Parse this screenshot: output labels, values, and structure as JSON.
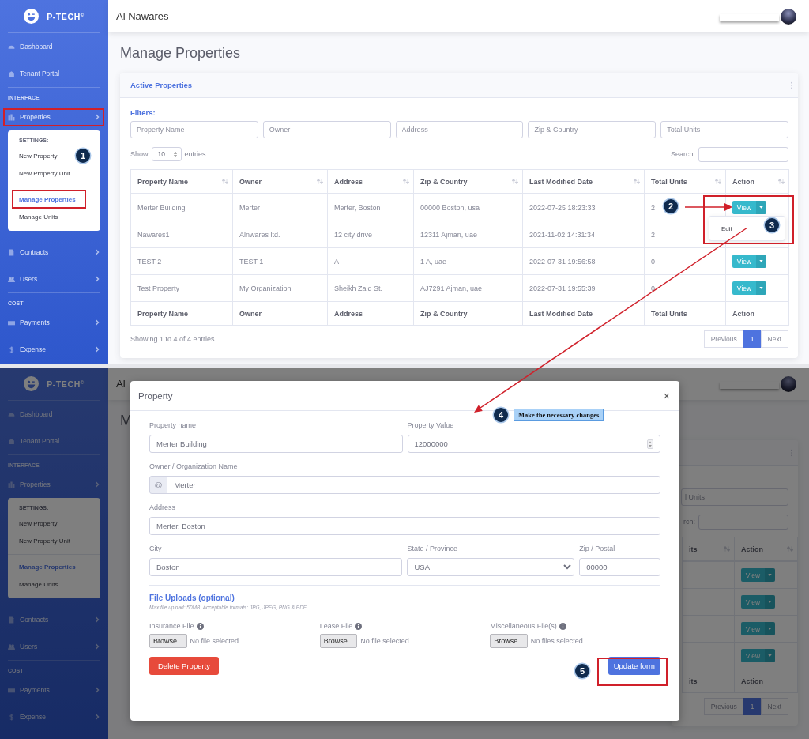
{
  "top_screen": {
    "brand": "P-TECH$^{©}$",
    "sidebar": {
      "items": [
        {
          "kind": "link",
          "label": "Dashboard"
        },
        {
          "kind": "link",
          "label": "Tenant Portal"
        },
        {
          "kind": "heading",
          "label": "INTERFACE"
        },
        {
          "kind": "group",
          "label": "Properties",
          "expanded": true,
          "sections": [
            {
              "heading": "SETTINGS:",
              "items": [
                {
                  "label": "New Property",
                  "selected": false
                },
                {
                  "label": "New Property Unit",
                  "selected": false
                }
              ]
            },
            {
              "items": [
                {
                  "label": "Manage Properties",
                  "selected": true
                },
                {
                  "label": "Manage Units",
                  "selected": false
                }
              ]
            }
          ]
        },
        {
          "kind": "group",
          "label": "Contracts"
        },
        {
          "kind": "group",
          "label": "Users"
        },
        {
          "kind": "heading",
          "label": "COST"
        },
        {
          "kind": "group",
          "label": "Payments"
        },
        {
          "kind": "group",
          "label": "Expense"
        }
      ]
    },
    "topbar": {
      "title": "Al Nawares"
    },
    "page_title": "Manage Properties",
    "card": {
      "title": "Active Properties",
      "filters_label": "Filters:",
      "filters": [
        {
          "placeholder": "Property Name"
        },
        {
          "placeholder": "Owner"
        },
        {
          "placeholder": "Address"
        },
        {
          "placeholder": "Zip & Country"
        },
        {
          "placeholder": "Total Units"
        }
      ],
      "length_menu": {
        "before": "Show",
        "value": "10",
        "after": "entries"
      },
      "search_label": "Search:",
      "columns": [
        "Property Name",
        "Owner",
        "Address",
        "Zip & Country",
        "Last Modified Date",
        "Total Units",
        "Action"
      ],
      "rows": [
        {
          "cells": [
            "Merter Building",
            "Merter",
            "Merter, Boston",
            "00000 Boston, usa",
            "2022-07-25 18:23:33",
            "2"
          ],
          "action": "View",
          "menu": [
            "Edit"
          ]
        },
        {
          "cells": [
            "Nawares1",
            "Alnwares ltd.",
            "12 city drive",
            "12311 Ajman, uae",
            "2021-11-02 14:31:34",
            "2"
          ]
        },
        {
          "cells": [
            "TEST 2",
            "TEST 1",
            "A",
            "1 A, uae",
            "2022-07-31 19:56:58",
            "0"
          ],
          "action": "View"
        },
        {
          "cells": [
            "Test Property",
            "My Organization",
            "Sheikh Zaid St.",
            "AJ7291 Ajman, uae",
            "2022-07-31 19:55:39",
            "0"
          ],
          "action": "View"
        }
      ],
      "footer_columns": [
        "Property Name",
        "Owner",
        "Address",
        "Zip & Country",
        "Last Modified Date",
        "Total Units",
        "Action"
      ],
      "info": "Showing 1 to 4 of 4 entries",
      "pagination": [
        {
          "label": "Previous",
          "selected": false
        },
        {
          "label": "1",
          "selected": true
        },
        {
          "label": "Next",
          "selected": false
        }
      ]
    }
  },
  "bottom_screen": {
    "brand": "P-TECH$^{©}$",
    "modal_open": true,
    "sidebar": {
      "items": [
        {
          "kind": "link",
          "label": "Dashboard"
        },
        {
          "kind": "link",
          "label": "Tenant Portal"
        },
        {
          "kind": "heading",
          "label": "INTERFACE"
        },
        {
          "kind": "group",
          "label": "Properties",
          "expanded": true,
          "sections": [
            {
              "heading": "SETTINGS:",
              "items": [
                {
                  "label": "New Property",
                  "selected": false
                },
                {
                  "label": "New Property Unit",
                  "selected": false
                }
              ]
            },
            {
              "items": [
                {
                  "label": "Manage Properties",
                  "selected": true
                },
                {
                  "label": "Manage Units",
                  "selected": false
                }
              ]
            }
          ]
        },
        {
          "kind": "group",
          "label": "Contracts"
        },
        {
          "kind": "group",
          "label": "Users"
        },
        {
          "kind": "heading",
          "label": "COST"
        },
        {
          "kind": "group",
          "label": "Payments"
        },
        {
          "kind": "group",
          "label": "Expense"
        }
      ]
    },
    "topbar": {
      "title": "Al"
    },
    "page_title": "M",
    "card": {
      "filters": [
        {
          "placeholder": "l Units"
        }
      ],
      "search_label": "rch:",
      "columns": [
        "its",
        "Action"
      ],
      "rows": [
        {
          "action": "View"
        },
        {
          "action": "View"
        },
        {
          "action": "View"
        },
        {
          "action": "View"
        }
      ],
      "footer_columns": [
        "its",
        "Action"
      ],
      "pagination": [
        {
          "label": "Previous",
          "selected": false
        },
        {
          "label": "1",
          "selected": true
        },
        {
          "label": "Next",
          "selected": false
        }
      ]
    },
    "modal": {
      "title": "Property",
      "close": "×",
      "rows": [
        {
          "fields": [
            {
              "kind": "text",
              "label": "Property name",
              "value": "Merter Building"
            },
            {
              "kind": "number",
              "label": "Property Value",
              "value": "12000000"
            }
          ]
        },
        {
          "fields": [
            {
              "kind": "prefixed",
              "label": "Owner / Organization Name",
              "prefix": "@",
              "value": "Merter"
            }
          ]
        },
        {
          "fields": [
            {
              "kind": "text",
              "label": "Address",
              "value": "Merter, Boston"
            }
          ]
        },
        {
          "fields": [
            {
              "kind": "text",
              "label": "City",
              "value": "Boston"
            },
            {
              "kind": "select",
              "label": "State / Province",
              "value": "USA"
            },
            {
              "kind": "text",
              "label": "Zip / Postal",
              "value": "00000"
            }
          ]
        }
      ],
      "uploads": {
        "title": "File Uploads (optional)",
        "hint": "Max file upload: 50MB. Acceptable formats: JPG, JPEG, PNG & PDF",
        "files": [
          {
            "label": "Insurance File",
            "button": "Browse...",
            "status": "No file selected."
          },
          {
            "label": "Lease File",
            "button": "Browse...",
            "status": "No file selected."
          },
          {
            "label": "Miscellaneous File(s)",
            "button": "Browse...",
            "status": "No files selected."
          }
        ]
      },
      "buttons": [
        {
          "kind": "danger",
          "label": "Delete Property"
        },
        {
          "kind": "primary",
          "label": "Update form"
        }
      ]
    }
  },
  "annotations": {
    "steps": [
      {
        "number": "1"
      },
      {
        "number": "2"
      },
      {
        "number": "3"
      },
      {
        "number": "4"
      },
      {
        "number": "5"
      }
    ],
    "note": "Make the necessary changes"
  }
}
